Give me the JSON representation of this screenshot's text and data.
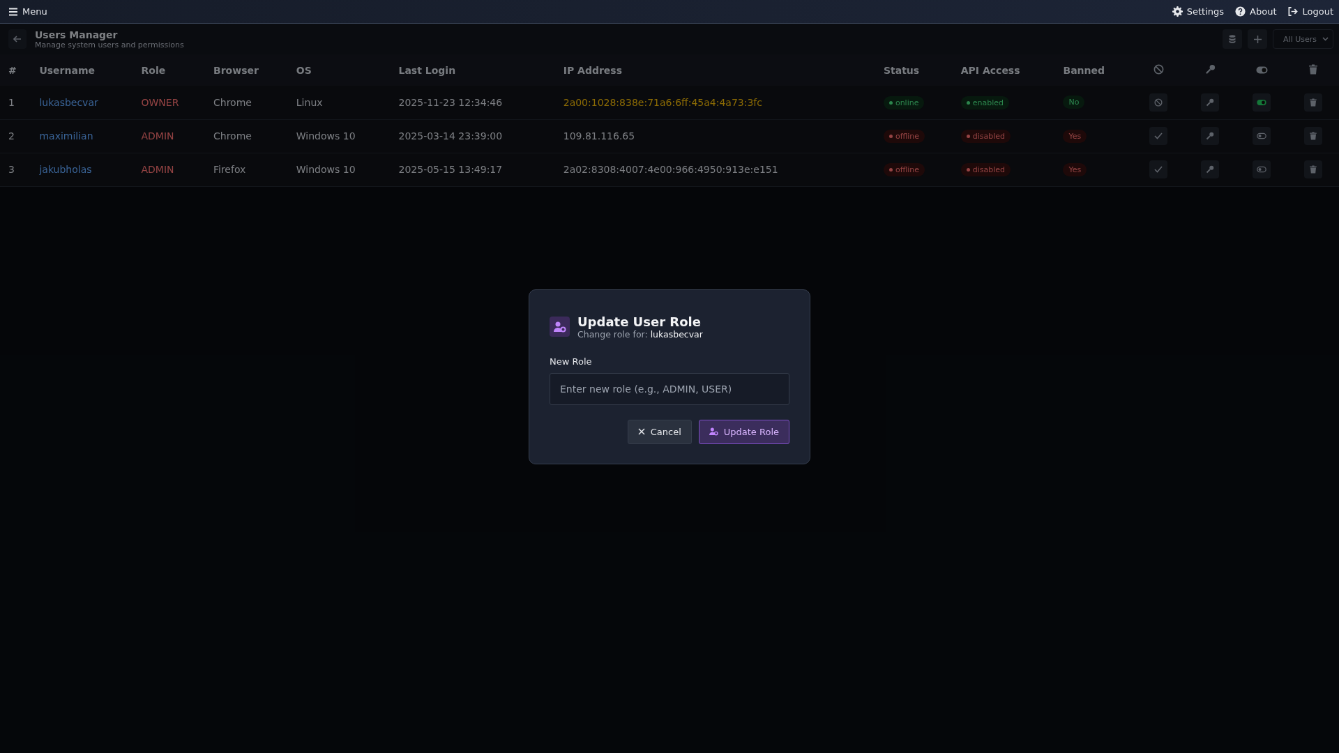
{
  "topbar": {
    "menu": "Menu",
    "links": [
      {
        "kind": "settings",
        "label": "Settings"
      },
      {
        "kind": "about",
        "label": "About"
      },
      {
        "kind": "logout",
        "label": "Logout"
      }
    ]
  },
  "header": {
    "title": "Users Manager",
    "subtitle": "Manage system users and permissions",
    "filter": "All Users"
  },
  "table": {
    "columns": [
      "#",
      "Username",
      "Role",
      "Browser",
      "OS",
      "Last Login",
      "IP Address",
      "Status",
      "API Access",
      "Banned"
    ],
    "rows": [
      {
        "index": "1",
        "username": "lukasbecvar",
        "role": "OWNER",
        "browser": "Chrome",
        "os": "Linux",
        "last_login": "2025-11-23 12:34:46",
        "ip": "2a00:1028:838e:71a6:6ff:45a4:4a73:3fc",
        "ip_highlighted": true,
        "status": "online",
        "online": true,
        "api": "enabled",
        "api_enabled": true,
        "banned_label": "No",
        "banned": false
      },
      {
        "index": "2",
        "username": "maximilian",
        "role": "ADMIN",
        "browser": "Chrome",
        "os": "Windows 10",
        "last_login": "2025-03-14 23:39:00",
        "ip": "109.81.116.65",
        "ip_highlighted": false,
        "status": "offline",
        "online": false,
        "api": "disabled",
        "api_enabled": false,
        "banned_label": "Yes",
        "banned": true
      },
      {
        "index": "3",
        "username": "jakubholas",
        "role": "ADMIN",
        "browser": "Firefox",
        "os": "Windows 10",
        "last_login": "2025-05-15 13:49:17",
        "ip": "2a02:8308:4007:4e00:966:4950:913e:e151",
        "ip_highlighted": false,
        "status": "offline",
        "online": false,
        "api": "disabled",
        "api_enabled": false,
        "banned_label": "Yes",
        "banned": true
      }
    ]
  },
  "dialog": {
    "title": "Update User Role",
    "subtitle": "Change role for: **lukasbecvar**",
    "field_label": "New Role",
    "placeholder": "Enter new role (e.g., ADMIN, USER)",
    "cancel": "Cancel",
    "submit": "Update Role"
  }
}
